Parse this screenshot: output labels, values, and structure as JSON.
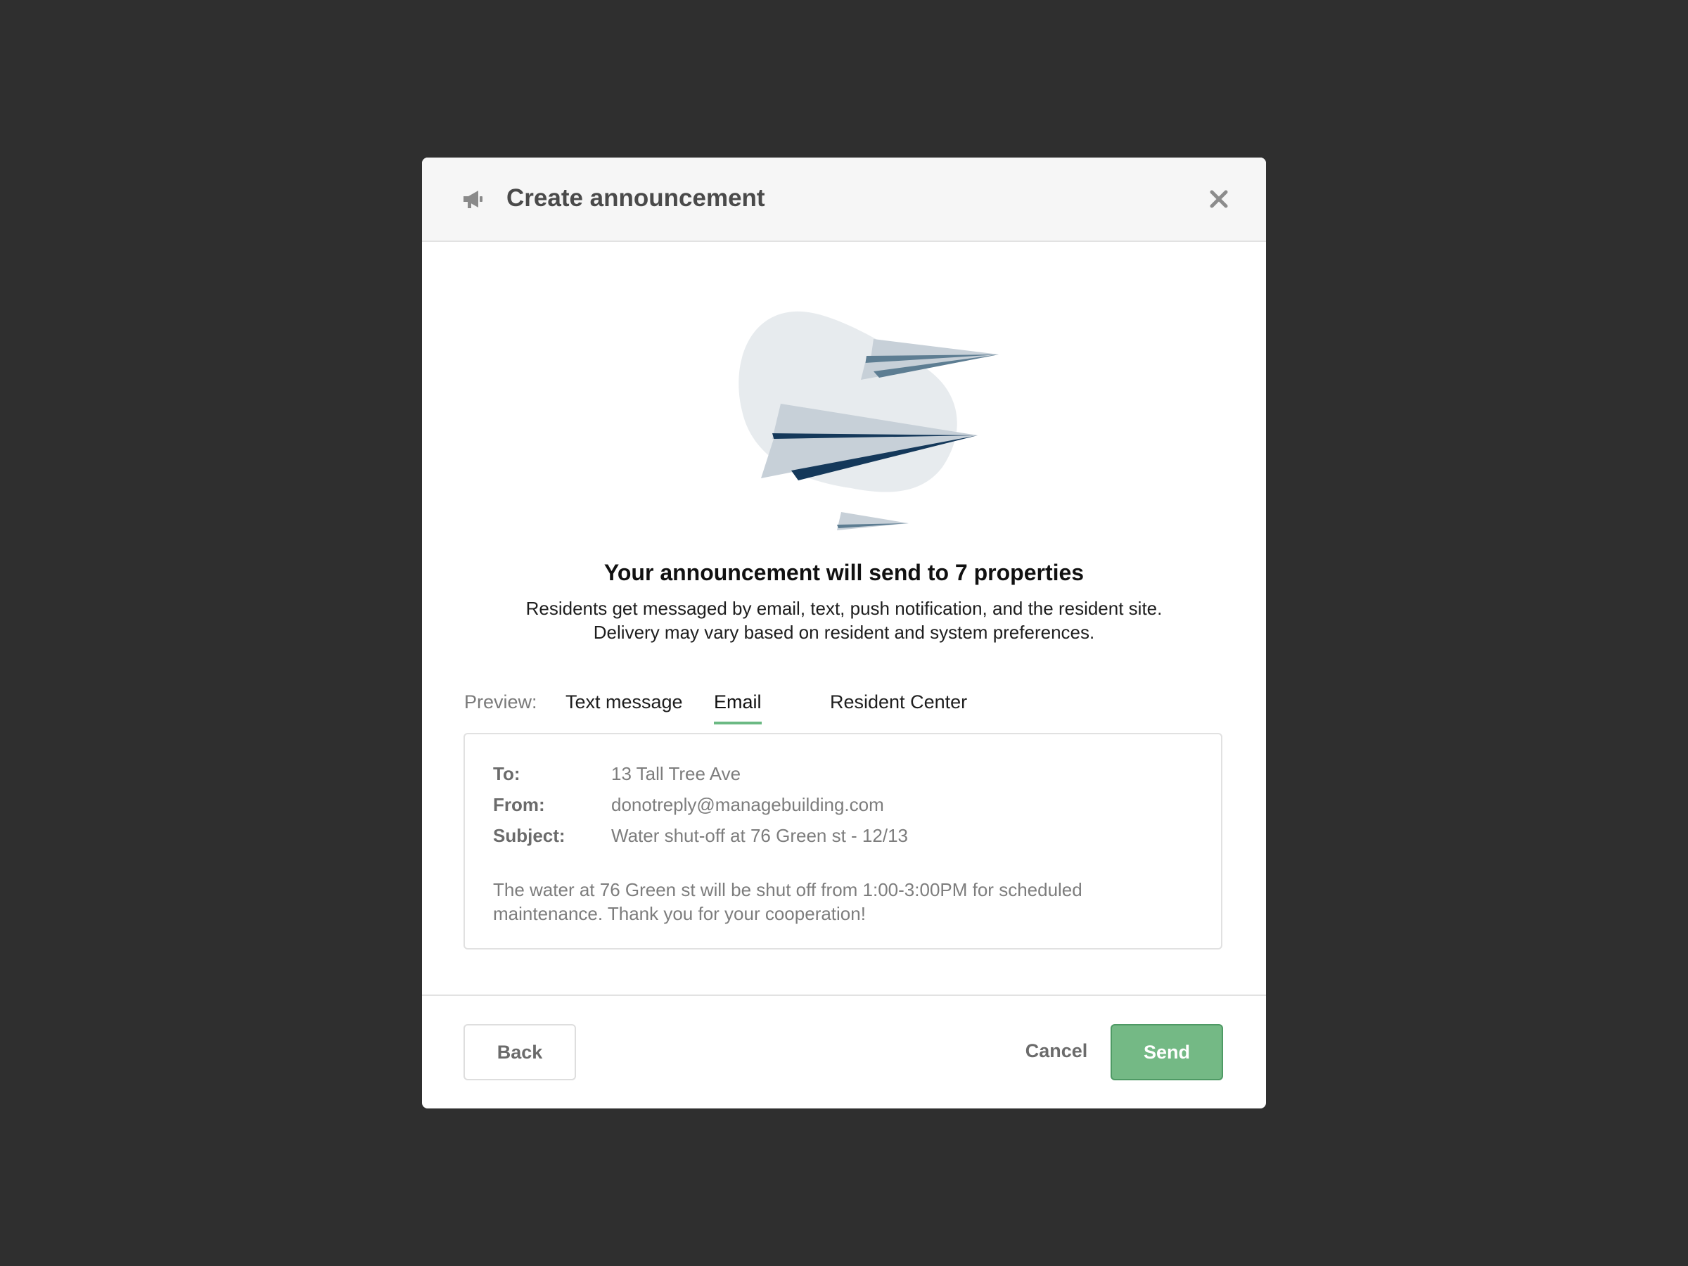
{
  "modal": {
    "title": "Create announcement",
    "header_icon": "megaphone-icon",
    "close_icon": "close-icon"
  },
  "summary": {
    "headline": "Your announcement will send to 7 properties",
    "description_line1": "Residents get messaged by email, text, push notification, and the resident site.",
    "description_line2": "Delivery may vary based on resident and system preferences."
  },
  "preview": {
    "label": "Preview:",
    "tabs": [
      {
        "label": "Text message",
        "active": false
      },
      {
        "label": "Email",
        "active": true
      },
      {
        "label": "Resident Center",
        "active": false
      }
    ],
    "accent_color": "#6bb983"
  },
  "email": {
    "to_label": "To:",
    "to_value": "13 Tall Tree Ave",
    "from_label": "From:",
    "from_value": "donotreply@managebuilding.com",
    "subject_label": "Subject:",
    "subject_value": "Water shut-off at 76 Green st - 12/13",
    "body": "The water at 76 Green st will be shut off from 1:00-3:00PM for scheduled maintenance. Thank you for your cooperation!"
  },
  "footer": {
    "back_label": "Back",
    "cancel_label": "Cancel",
    "send_label": "Send",
    "send_color": "#74b985"
  },
  "illustration": {
    "icon": "paper-planes-illustration"
  }
}
